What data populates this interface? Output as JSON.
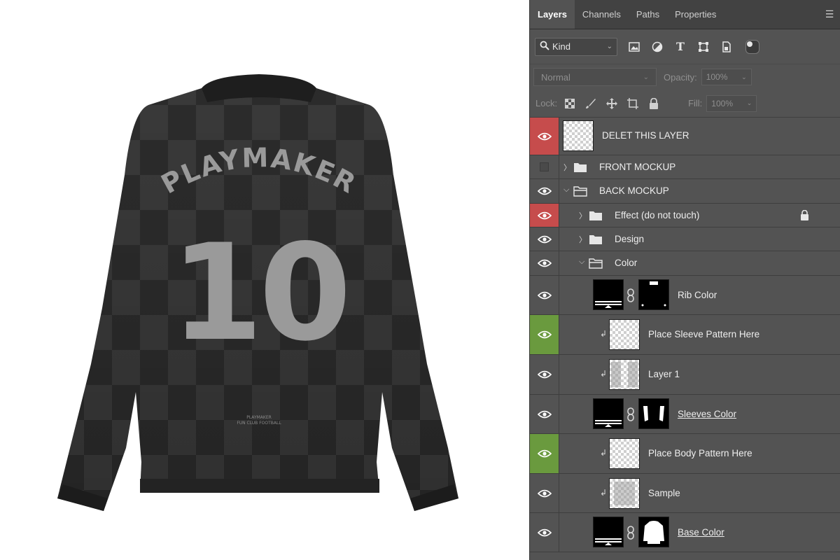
{
  "mockup": {
    "club_name": "PLAYMAKER",
    "number": "10",
    "label_line1": "PLAYMAKER",
    "label_line2": "FUN CLUB FOOTBALL",
    "colors": {
      "shirt": "#2f2f2f",
      "check_light": "#3b3b3b",
      "print": "#9a9a9a"
    }
  },
  "panel": {
    "tabs": [
      "Layers",
      "Channels",
      "Paths",
      "Properties"
    ],
    "filter_kind": "Kind",
    "blend_mode": "Normal",
    "opacity_label": "Opacity:",
    "opacity_value": "100%",
    "lock_label": "Lock:",
    "fill_label": "Fill:",
    "fill_value": "100%"
  },
  "layers": [
    {
      "name": "DELET THIS LAYER",
      "eye": "red",
      "kind": "thumb",
      "thumb": "checker"
    },
    {
      "name": "FRONT MOCKUP",
      "eye": "hidden",
      "kind": "folder",
      "expanded": false
    },
    {
      "name": "BACK MOCKUP",
      "eye": "visible",
      "kind": "folder",
      "expanded": true
    },
    {
      "name": "Effect (do not touch)",
      "eye": "red",
      "kind": "folder",
      "expanded": false,
      "locked": true
    },
    {
      "name": "Design",
      "eye": "visible",
      "kind": "folder",
      "expanded": false
    },
    {
      "name": "Color",
      "eye": "visible",
      "kind": "folder",
      "expanded": true
    },
    {
      "name": "Rib Color",
      "eye": "visible",
      "kind": "fill-mask"
    },
    {
      "name": "Place Sleeve Pattern Here",
      "eye": "green",
      "kind": "clipped"
    },
    {
      "name": "Layer 1",
      "eye": "visible",
      "kind": "clipped"
    },
    {
      "name": "Sleeves Color",
      "eye": "visible",
      "kind": "fill-mask"
    },
    {
      "name": "Place Body Pattern Here",
      "eye": "green",
      "kind": "clipped"
    },
    {
      "name": "Sample",
      "eye": "visible",
      "kind": "clipped"
    },
    {
      "name": "Base Color",
      "eye": "visible",
      "kind": "fill-mask"
    }
  ]
}
